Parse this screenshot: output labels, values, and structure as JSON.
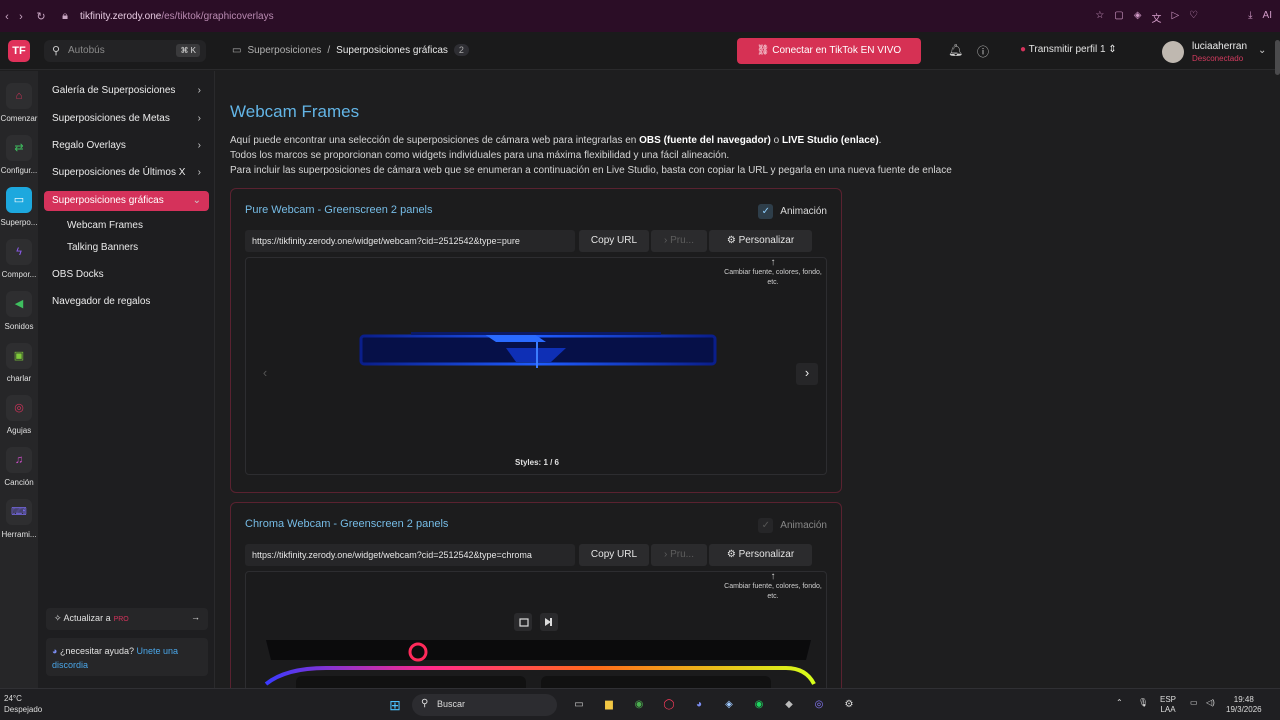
{
  "browser": {
    "url_domain": "tikfinity.zerody.one",
    "url_path": "/es/tiktok/graphicoverlays",
    "ai_label": "AI"
  },
  "header": {
    "logo_text": "TF",
    "search_placeholder": "Autobús",
    "search_shortcut": "⌘ K",
    "breadcrumb": [
      "Superposiciones",
      "/",
      "Superposiciones gráficas"
    ],
    "breadcrumb_count": "2",
    "connect_button": "Conectar en TikTok EN VIVO",
    "profile_label": "Transmitir perfil 1",
    "user_name": "luciaaherran",
    "user_status": "Desconectado"
  },
  "rail": [
    {
      "icon": "home-icon",
      "glyph": "⌂",
      "label": "Comenzar",
      "color": "#d5325b"
    },
    {
      "icon": "settings-icon",
      "glyph": "⇄",
      "label": "Configur...",
      "color": "#3fbf5f"
    },
    {
      "icon": "overlay-icon",
      "glyph": "▭",
      "label": "Superpo...",
      "color": "#ffffff"
    },
    {
      "icon": "actions-icon",
      "glyph": "⚡",
      "label": "Compor...",
      "color": "#8e5cf0"
    },
    {
      "icon": "sounds-icon",
      "glyph": "◀",
      "label": "Sonidos",
      "color": "#3fbf5f"
    },
    {
      "icon": "chat-icon",
      "glyph": "▣",
      "label": "charlar",
      "color": "#7ec93a"
    },
    {
      "icon": "games-icon",
      "glyph": "◎",
      "label": "Agujas",
      "color": "#d5325b"
    },
    {
      "icon": "song-icon",
      "glyph": "♫",
      "label": "Canción",
      "color": "#d54fd0"
    },
    {
      "icon": "tools-icon",
      "glyph": "⌨",
      "label": "Herrami...",
      "color": "#7a6df0"
    }
  ],
  "menu": {
    "items": [
      {
        "label": "Galería de Superposiciones",
        "chevron": "›"
      },
      {
        "label": "Superposiciones de Metas",
        "chevron": "›"
      },
      {
        "label": "Regalo Overlays",
        "chevron": "›"
      },
      {
        "label": "Superposiciones de Últimos X",
        "chevron": "›"
      },
      {
        "label": "Superposiciones gráficas",
        "chevron": "⌄"
      }
    ],
    "subitems": [
      "Webcam Frames",
      "Talking Banners"
    ],
    "items_after": [
      "OBS Docks",
      "Navegador de regalos"
    ],
    "upgrade_label": "Actualizar a",
    "upgrade_badge": "PRO",
    "help_text": "¿necesitar ayuda?",
    "help_link": "Unete una discordia"
  },
  "page": {
    "title": "Webcam Frames",
    "desc1_a": "Aquí puede encontrar una selección de superposiciones de cámara web para integrarlas en ",
    "desc1_b": "OBS (fuente del navegador)",
    "desc1_c": " o ",
    "desc1_d": "LIVE Studio (enlace)",
    "desc1_e": ".",
    "desc2": "Todos los marcos se proporcionan como widgets individuales para una máxima flexibilidad y una fácil alineación.",
    "desc3": "Para incluir las superposiciones de cámara web que se enumeran a continuación en Live Studio, basta con copiar la URL y pegarla en una nueva fuente de enlace"
  },
  "cards": [
    {
      "title": "Pure Webcam - Greenscreen 2 panels",
      "animation_label": "Animación",
      "animation_checked": true,
      "url": "https://tikfinity.zerody.one/widget/webcam?cid=2512542&type=pure",
      "copy_label": "Copy URL",
      "preview_label": "Pru...",
      "customize_label": "Personalizar",
      "tip": "Cambiar fuente, colores, fondo, etc.",
      "styles_label": "Styles: 1 / 6"
    },
    {
      "title": "Chroma Webcam - Greenscreen 2 panels",
      "animation_label": "Animación",
      "animation_checked": true,
      "url": "https://tikfinity.zerody.one/widget/webcam?cid=2512542&type=chroma",
      "copy_label": "Copy URL",
      "preview_label": "Pru...",
      "customize_label": "Personalizar",
      "tip": "Cambiar fuente, colores, fondo, etc."
    }
  ],
  "taskbar": {
    "weather_temp": "24°C",
    "weather_desc": "Despejado",
    "search_label": "Buscar",
    "lang1": "ESP",
    "lang2": "LAA",
    "time": "19:48",
    "date": "19/3/2026"
  }
}
